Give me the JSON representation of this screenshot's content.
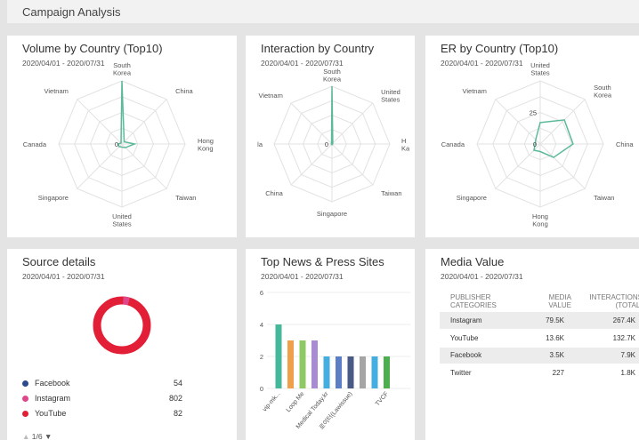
{
  "page": {
    "title": "Campaign Analysis"
  },
  "colors": {
    "radar": "#5cba9a",
    "donut_main": "#e31e37",
    "donut_secondary": "#e0478a"
  },
  "cards": {
    "volume": {
      "title": "Volume by Country (Top10)",
      "date": "2020/04/01 - 2020/07/31"
    },
    "interaction": {
      "title": "Interaction by Country",
      "date": "2020/04/01 - 2020/07/31"
    },
    "er": {
      "title": "ER by Country (Top10)",
      "date": "2020/04/01 - 2020/07/31"
    },
    "source": {
      "title": "Source details",
      "date": "2020/04/01 - 2020/07/31"
    },
    "news": {
      "title": "Top News & Press Sites",
      "date": "2020/04/01 - 2020/07/31"
    },
    "media": {
      "title": "Media Value",
      "date": "2020/04/01 - 2020/07/31"
    }
  },
  "chart_data": [
    {
      "type": "radar",
      "categories": [
        "South Korea",
        "China",
        "Hong Kong",
        "Taiwan",
        "United States",
        "Singapore",
        "Canada",
        "Vietnam"
      ],
      "tick_labels": [
        "0"
      ],
      "values": [
        1.0,
        0.05,
        0.2,
        0.08,
        0.05,
        0.06,
        0.06,
        0.02
      ]
    },
    {
      "type": "radar",
      "categories": [
        "South Korea",
        "United States",
        "Hong Kong",
        "Taiwan",
        "Singapore",
        "China",
        "Canada",
        "Vietnam"
      ],
      "visible_labels": [
        "South Korea",
        "United States",
        "H Ka",
        "Taiwan",
        "Singapore",
        "China",
        "la",
        "Vietnam"
      ],
      "tick_labels": [
        "0"
      ],
      "values": [
        1.0,
        0.02,
        0.01,
        0.01,
        0.01,
        0.01,
        0.01,
        0.01
      ]
    },
    {
      "type": "radar",
      "categories": [
        "United States",
        "South Korea",
        "China",
        "Taiwan",
        "Hong Kong",
        "Singapore",
        "Canada",
        "Vietnam"
      ],
      "tick_labels": [
        "0",
        "25"
      ],
      "values": [
        17,
        27,
        26,
        15,
        6,
        7,
        4,
        5
      ],
      "rmax": 50
    },
    {
      "type": "pie",
      "series": [
        {
          "name": "Facebook",
          "value": 54,
          "color": "#2d4a8a"
        },
        {
          "name": "Instagram",
          "value": 802,
          "color": "#e0478a"
        },
        {
          "name": "YouTube",
          "value": 82,
          "color": "#e31e37"
        }
      ],
      "pager": "1/6"
    },
    {
      "type": "bar",
      "categories": [
        "vip-mk...",
        "Loop Me",
        "Medical Today.kr",
        "로이터(Lawissue)",
        "TVCF",
        "",
        "",
        "",
        "",
        ""
      ],
      "values": [
        4,
        3,
        3,
        3,
        2,
        2,
        2,
        2,
        2,
        2
      ],
      "colors": [
        "#45b89a",
        "#f0a04b",
        "#8fc964",
        "#a98bd3",
        "#45aee0",
        "#5b7ec7",
        "#4a5a86",
        "#a5a5a5",
        "#45aee0",
        "#4cae4c"
      ],
      "yticks": [
        "0",
        "2",
        "4",
        "6"
      ],
      "ylim": [
        0,
        6
      ]
    },
    {
      "type": "table",
      "headers": [
        "PUBLISHER CATEGORIES",
        "MEDIA VALUE",
        "INTERACTIONS (TOTAL)"
      ],
      "rows": [
        [
          "Instagram",
          "79.5K",
          "267.4K"
        ],
        [
          "YouTube",
          "13.6K",
          "132.7K"
        ],
        [
          "Facebook",
          "3.5K",
          "7.9K"
        ],
        [
          "Twitter",
          "227",
          "1.8K"
        ]
      ]
    }
  ]
}
